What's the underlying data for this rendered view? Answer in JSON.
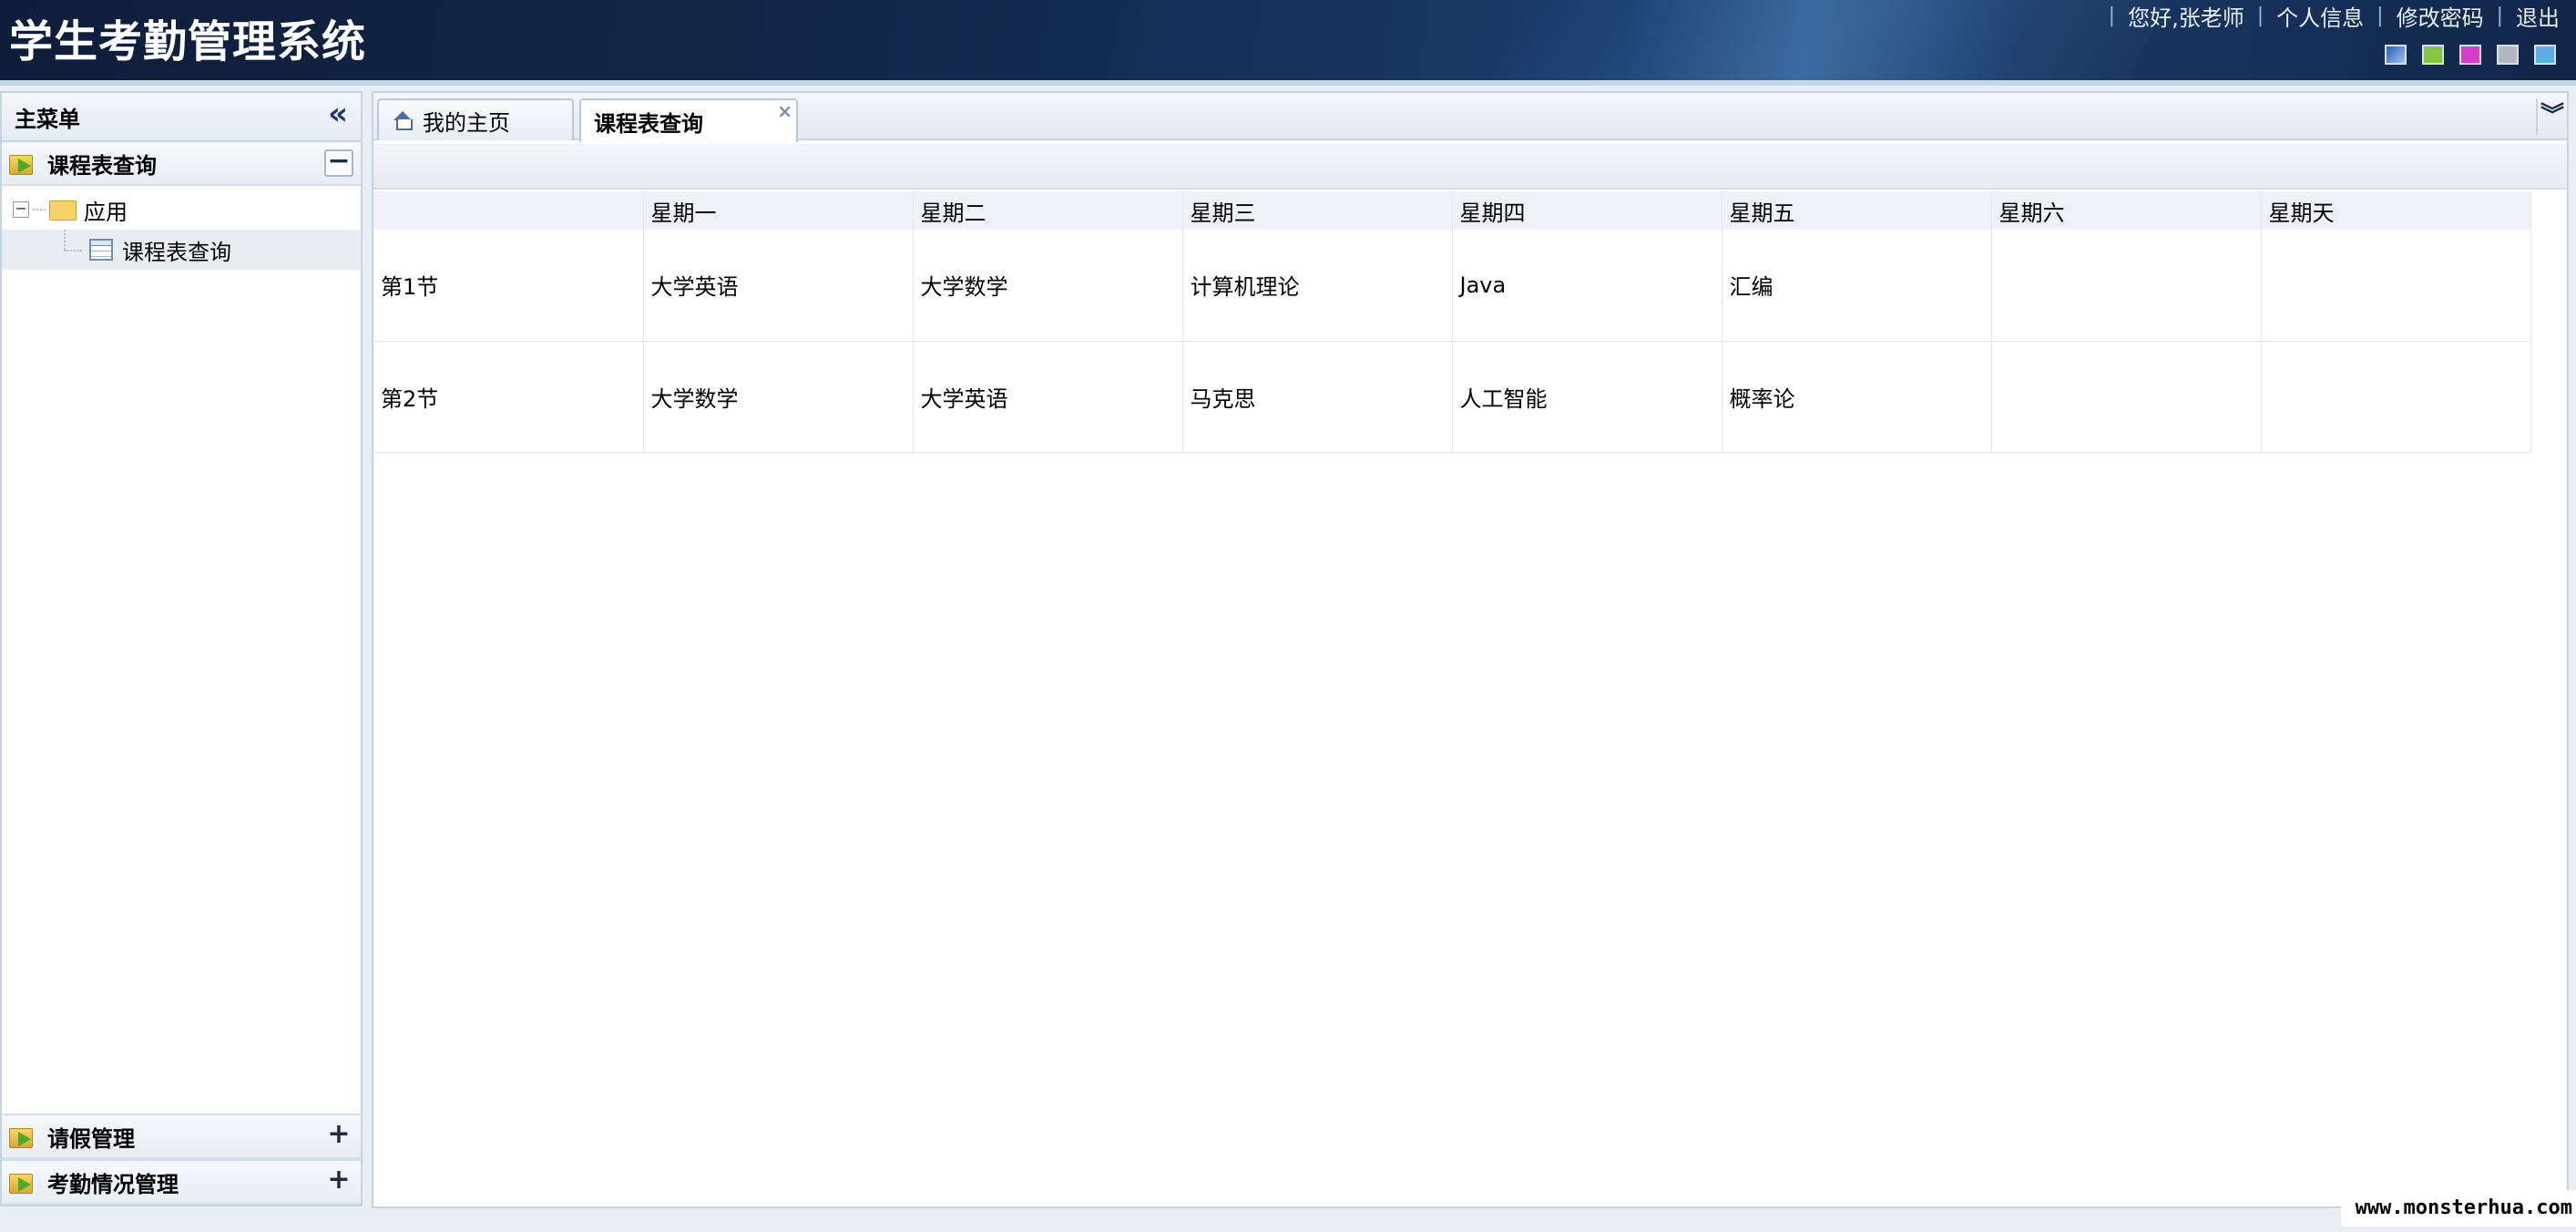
{
  "header": {
    "app_title": "学生考勤管理系统",
    "greeting": "您好,张老师",
    "profile_link": "个人信息",
    "password_link": "修改密码",
    "logout_link": "退出",
    "separator": "|",
    "theme_swatches": [
      {
        "name": "default",
        "color": "#2a5fb5"
      },
      {
        "name": "green",
        "color": "#86c540"
      },
      {
        "name": "pink",
        "color": "#d93bc9"
      },
      {
        "name": "gray",
        "color": "#b4b7bc"
      },
      {
        "name": "blue",
        "color": "#5aafe8"
      }
    ]
  },
  "sidebar": {
    "title": "主菜单",
    "collapse_glyph": "«",
    "sections": [
      {
        "label": "课程表查询",
        "expanded": true,
        "toggle": "−",
        "tree": {
          "folder": "应用",
          "items": [
            "课程表查询"
          ]
        }
      },
      {
        "label": "请假管理",
        "expanded": false,
        "toggle": "+"
      },
      {
        "label": "考勤情况管理",
        "expanded": false,
        "toggle": "+"
      }
    ]
  },
  "tabs": [
    {
      "label": "我的主页",
      "active": false
    },
    {
      "label": "课程表查询",
      "active": true,
      "close": "×"
    }
  ],
  "tab_menu_glyph": "⌄",
  "timetable": {
    "columns": [
      "",
      "星期一",
      "星期二",
      "星期三",
      "星期四",
      "星期五",
      "星期六",
      "星期天"
    ],
    "rows": [
      [
        "第1节",
        "大学英语",
        "大学数学",
        "计算机理论",
        "Java",
        "汇编",
        "",
        ""
      ],
      [
        "第2节",
        "大学数学",
        "大学英语",
        "马克思",
        "人工智能",
        "概率论",
        "",
        ""
      ]
    ]
  },
  "watermark": "www.monsterhua.com"
}
